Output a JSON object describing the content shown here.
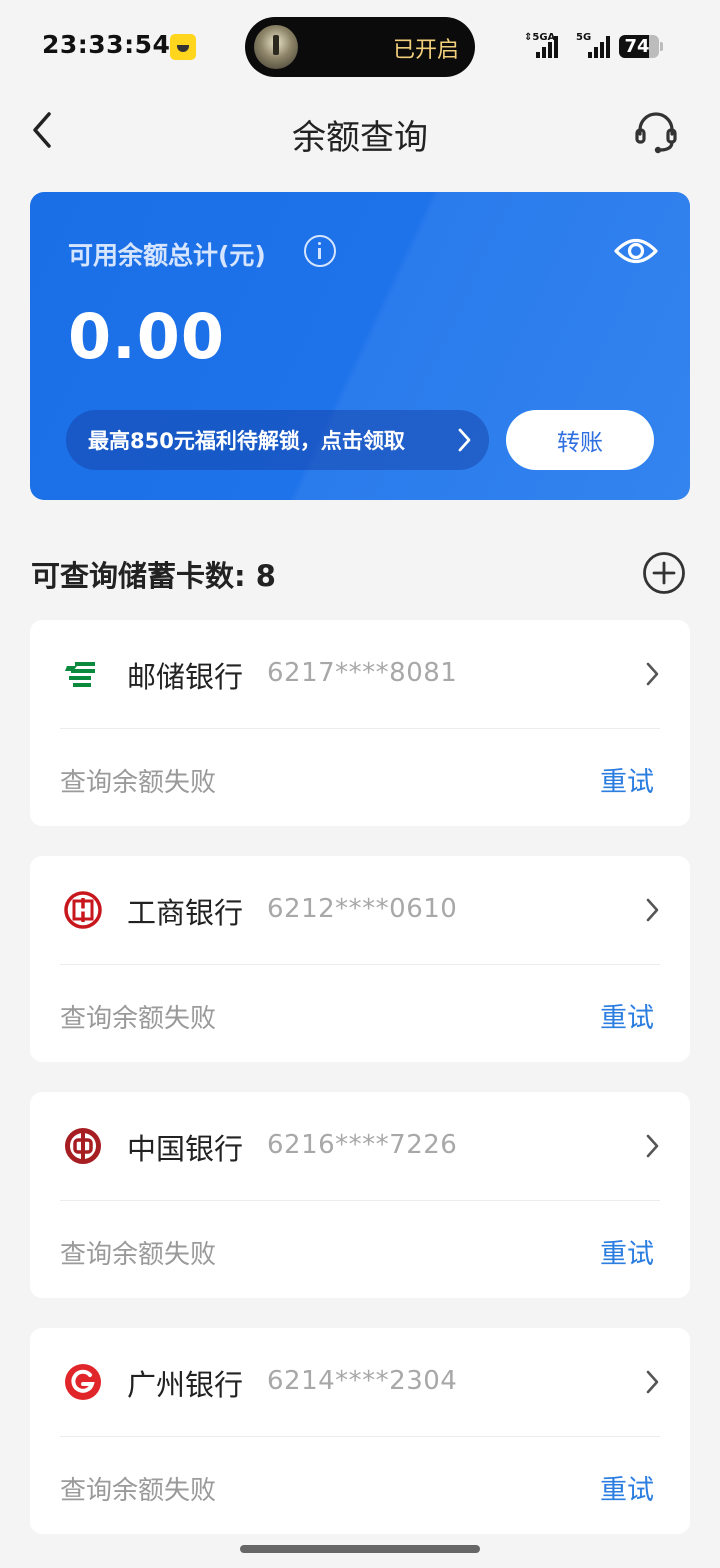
{
  "status_bar": {
    "time": "23:33:54",
    "flashlight_status": "已开启",
    "signal_1_label": "⇕5GA",
    "signal_2_label": "5G",
    "battery_percent": "74",
    "battery_level": 0.74
  },
  "nav": {
    "title": "余额查询",
    "back_icon": "chevron-left-icon",
    "service_icon": "headset-icon"
  },
  "balance": {
    "label": "可用余额总计(元)",
    "amount": "0.00",
    "promo_text": "最高850元福利待解锁，点击领取",
    "transfer_label": "转账"
  },
  "cards_section": {
    "count_label": "可查询储蓄卡数: 8",
    "cards": [
      {
        "bank": "邮储银行",
        "number": "6217****8081",
        "status": "查询余额失败",
        "action": "重试",
        "logo_color": "#0b8a3e"
      },
      {
        "bank": "工商银行",
        "number": "6212****0610",
        "status": "查询余额失败",
        "action": "重试",
        "logo_color": "#c8161d"
      },
      {
        "bank": "中国银行",
        "number": "6216****7226",
        "status": "查询余额失败",
        "action": "重试",
        "logo_color": "#a71e22"
      },
      {
        "bank": "广州银行",
        "number": "6214****2304",
        "status": "查询余额失败",
        "action": "重试",
        "logo_color": "#e0262b"
      }
    ]
  },
  "colors": {
    "accent_blue": "#2b7de0",
    "card_blue": "#1e72ea",
    "background": "#f4f4f4"
  }
}
